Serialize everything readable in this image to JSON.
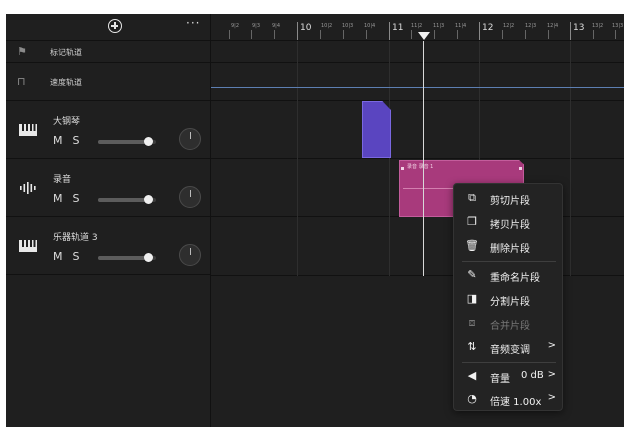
{
  "toolbar": {
    "add_icon": "plus-circle-icon",
    "more_label": "···"
  },
  "meta_tracks": [
    {
      "label": "标记轨道",
      "icon": "flag-icon"
    },
    {
      "label": "速度轨道",
      "icon": "tempo-icon"
    }
  ],
  "tracks": [
    {
      "name": "大钢琴",
      "mute": "M",
      "solo": "S",
      "icon": "piano-icon",
      "volume": 0.86
    },
    {
      "name": "录音",
      "mute": "M",
      "solo": "S",
      "icon": "audio-wave-icon",
      "volume": 0.86
    },
    {
      "name": "乐器轨道 3",
      "mute": "M",
      "solo": "S",
      "icon": "piano-icon",
      "volume": 0.86
    }
  ],
  "ruler": {
    "major": [
      "10",
      "11",
      "12",
      "13"
    ],
    "minor": [
      "9|2",
      "9|3",
      "9|4",
      "10|2",
      "10|3",
      "10|4",
      "11|2",
      "11|3",
      "11|4",
      "12|2",
      "12|3",
      "12|4",
      "13|2",
      "13|3"
    ]
  },
  "clips": {
    "audio_label": "录音 录音 1"
  },
  "context_menu": {
    "items": [
      {
        "label": "剪切片段",
        "icon": "cut-icon"
      },
      {
        "label": "拷贝片段",
        "icon": "copy-icon"
      },
      {
        "label": "删除片段",
        "icon": "trash-icon"
      },
      {
        "label": "重命名片段",
        "icon": "pencil-icon"
      },
      {
        "label": "分割片段",
        "icon": "split-icon"
      },
      {
        "label": "合并片段",
        "icon": "merge-icon",
        "disabled": true
      },
      {
        "label": "音频变调",
        "icon": "pitch-icon",
        "arrow": ">"
      },
      {
        "label": "音量",
        "icon": "volume-icon",
        "value": "0 dB",
        "arrow": ">"
      },
      {
        "label": "倍速 1.00x",
        "icon": "speed-icon",
        "arrow": ">"
      }
    ]
  }
}
